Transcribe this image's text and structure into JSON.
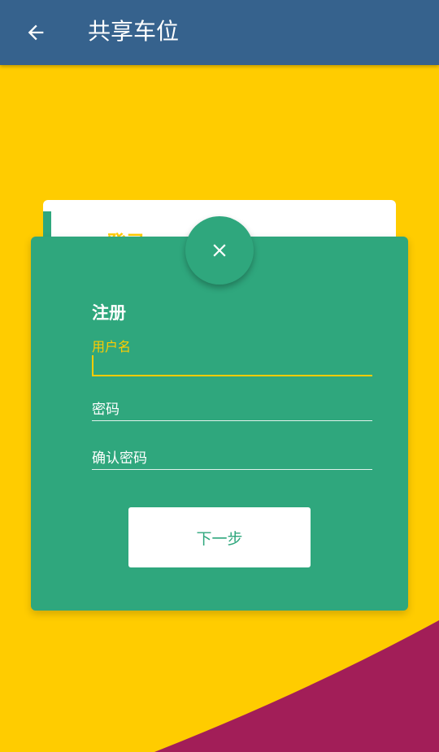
{
  "appbar": {
    "title": "共享车位",
    "back_icon": "arrow-left-icon"
  },
  "colors": {
    "appbar": "#36628d",
    "background": "#ffcc00",
    "card_green": "#2fa77d",
    "wave": "#a21e58",
    "accent_yellow": "#ffcc00"
  },
  "login_card": {
    "title": "登录"
  },
  "close_button": {
    "icon": "close-icon"
  },
  "register": {
    "title": "注册",
    "fields": [
      {
        "label": "用户名",
        "value": "",
        "focused": true
      },
      {
        "label": "密码",
        "value": ""
      },
      {
        "label": "确认密码",
        "value": ""
      }
    ],
    "next_label": "下一步"
  }
}
